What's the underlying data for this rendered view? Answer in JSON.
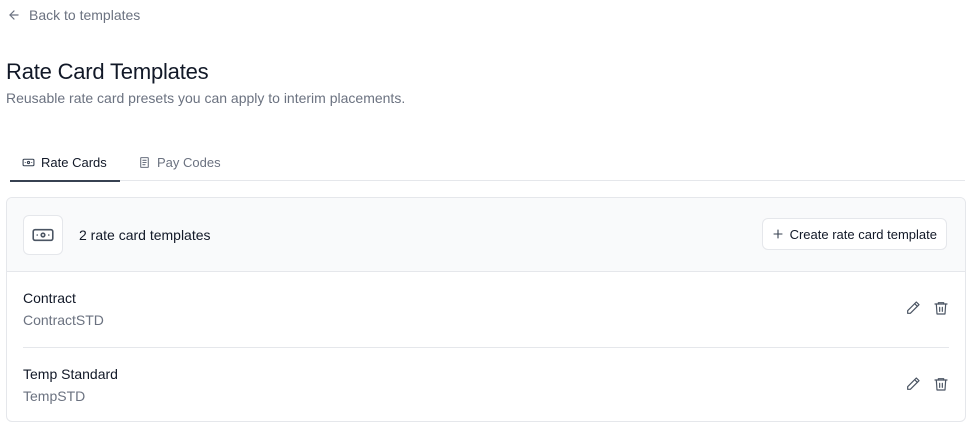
{
  "back": {
    "label": "Back to templates",
    "icon": "arrow-left-icon"
  },
  "header": {
    "title": "Rate Card Templates",
    "subtitle": "Reusable rate card presets you can apply to interim placements."
  },
  "tabs": [
    {
      "label": "Rate Cards",
      "icon": "banknote-icon",
      "active": true
    },
    {
      "label": "Pay Codes",
      "icon": "receipt-icon",
      "active": false
    }
  ],
  "card": {
    "count_label": "2 rate card templates",
    "header_icon": "banknote-icon",
    "create_label": "Create rate card template",
    "create_icon": "plus-icon"
  },
  "templates": [
    {
      "name": "Contract",
      "code": "ContractSTD"
    },
    {
      "name": "Temp Standard",
      "code": "TempSTD"
    }
  ],
  "colors": {
    "text_primary": "#111827",
    "text_muted": "#6b7280",
    "border": "#e5e7eb",
    "header_bg": "#f9fafb",
    "icon": "#4b5563"
  }
}
